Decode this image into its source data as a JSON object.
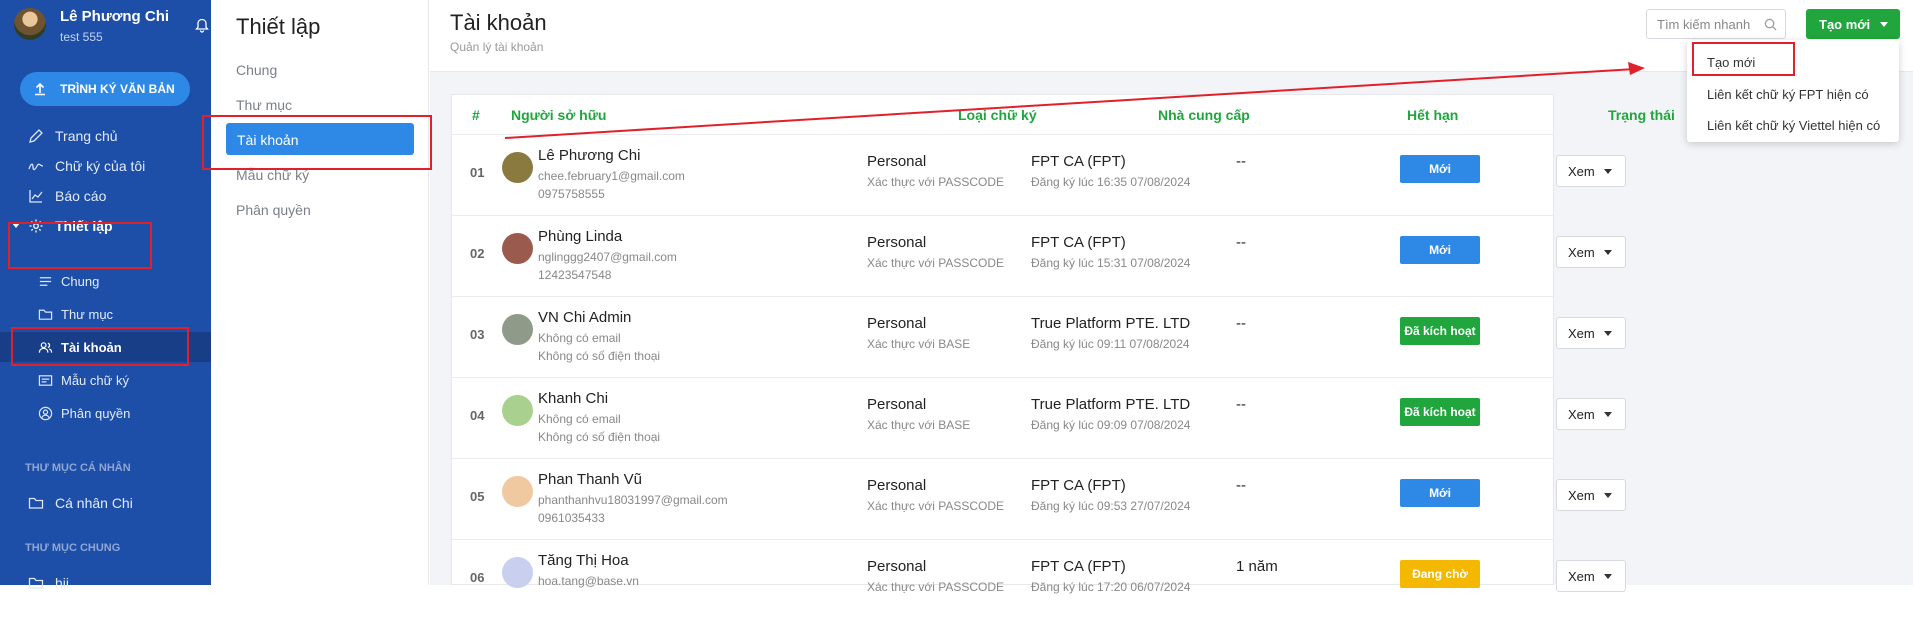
{
  "sidebar": {
    "user_name": "Lê Phương Chi",
    "user_sub": "test 555",
    "sign_button": "TRÌNH KÝ VĂN BẢN",
    "nav": [
      {
        "label": "Trang chủ",
        "icon": "edit-icon"
      },
      {
        "label": "Chữ ký của tôi",
        "icon": "signature-icon"
      },
      {
        "label": "Báo cáo",
        "icon": "chart-icon"
      },
      {
        "label": "Thiết lập",
        "icon": "gear-icon"
      }
    ],
    "subnav": [
      {
        "label": "Chung",
        "icon": "lines-icon"
      },
      {
        "label": "Thư mục",
        "icon": "folder-icon"
      },
      {
        "label": "Tài khoản",
        "icon": "users-icon"
      },
      {
        "label": "Mẫu chữ ký",
        "icon": "card-icon"
      },
      {
        "label": "Phân quyền",
        "icon": "user-circle-icon"
      }
    ],
    "section_personal": "THƯ MỤC CÁ NHÂN",
    "personal_folder": "Cá nhân Chi",
    "section_shared": "THƯ MỤC CHUNG",
    "shared_folder": "hii"
  },
  "settings": {
    "title": "Thiết lập",
    "items": [
      "Chung",
      "Thư mục",
      "Tài khoản",
      "Mẫu chữ ký",
      "Phân quyền"
    ]
  },
  "header": {
    "title": "Tài khoản",
    "subtitle": "Quản lý tài khoản",
    "search_placeholder": "Tìm kiếm nhanh",
    "create_button": "Tạo mới"
  },
  "create_menu": [
    "Tạo mới",
    "Liên kết chữ ký FPT hiện có",
    "Liên kết chữ ký Viettel hiện có"
  ],
  "table": {
    "headers": [
      "#",
      "Người sở hữu",
      "Loại chữ ký",
      "Nhà cung cấp",
      "Hết hạn",
      "Trạng thái"
    ],
    "rows": [
      {
        "num": "01",
        "name": "Lê Phương Chi",
        "email": "chee.february1@gmail.com",
        "phone": "0975758555",
        "type": "Personal",
        "auth": "Xác thực với PASSCODE",
        "provider": "FPT CA (FPT)",
        "registered": "Đăng ký lúc 16:35 07/08/2024",
        "expire": "--",
        "status": "Mới",
        "status_color": "#2e89e6",
        "view": "Xem",
        "avatar_color": "#8a7a3f"
      },
      {
        "num": "02",
        "name": "Phùng Linda",
        "email": "nglinggg2407@gmail.com",
        "phone": "12423547548",
        "type": "Personal",
        "auth": "Xác thực với PASSCODE",
        "provider": "FPT CA (FPT)",
        "registered": "Đăng ký lúc 15:31 07/08/2024",
        "expire": "--",
        "status": "Mới",
        "status_color": "#2e89e6",
        "view": "Xem",
        "avatar_color": "#9b5a4e"
      },
      {
        "num": "03",
        "name": "VN Chi Admin",
        "email": "Không có email",
        "phone": "Không có số điện thoại",
        "type": "Personal",
        "auth": "Xác thực với BASE",
        "provider": "True Platform PTE. LTD",
        "registered": "Đăng ký lúc 09:11 07/08/2024",
        "expire": "--",
        "status": "Đã kích hoạt",
        "status_color": "#20a63d",
        "view": "Xem",
        "avatar_color": "#8f9a88"
      },
      {
        "num": "04",
        "name": "Khanh Chi",
        "email": "Không có email",
        "phone": "Không có số điện thoại",
        "type": "Personal",
        "auth": "Xác thực với BASE",
        "provider": "True Platform PTE. LTD",
        "registered": "Đăng ký lúc 09:09 07/08/2024",
        "expire": "--",
        "status": "Đã kích hoạt",
        "status_color": "#20a63d",
        "view": "Xem",
        "avatar_color": "#a9d08e"
      },
      {
        "num": "05",
        "name": "Phan Thanh Vũ",
        "email": "phanthanhvu18031997@gmail.com",
        "phone": "0961035433",
        "type": "Personal",
        "auth": "Xác thực với PASSCODE",
        "provider": "FPT CA (FPT)",
        "registered": "Đăng ký lúc 09:53 27/07/2024",
        "expire": "--",
        "status": "Mới",
        "status_color": "#2e89e6",
        "view": "Xem",
        "avatar_color": "#f0c9a0"
      },
      {
        "num": "06",
        "name": "Tăng Thị Hoa",
        "email": "hoa.tang@base.vn",
        "phone": "",
        "type": "Personal",
        "auth": "Xác thực với PASSCODE",
        "provider": "FPT CA (FPT)",
        "registered": "Đăng ký lúc 17:20 06/07/2024",
        "expire": "1 năm",
        "status": "Đang chờ",
        "status_color": "#f5b800",
        "view": "Xem",
        "avatar_color": "#c9cfee"
      }
    ]
  }
}
